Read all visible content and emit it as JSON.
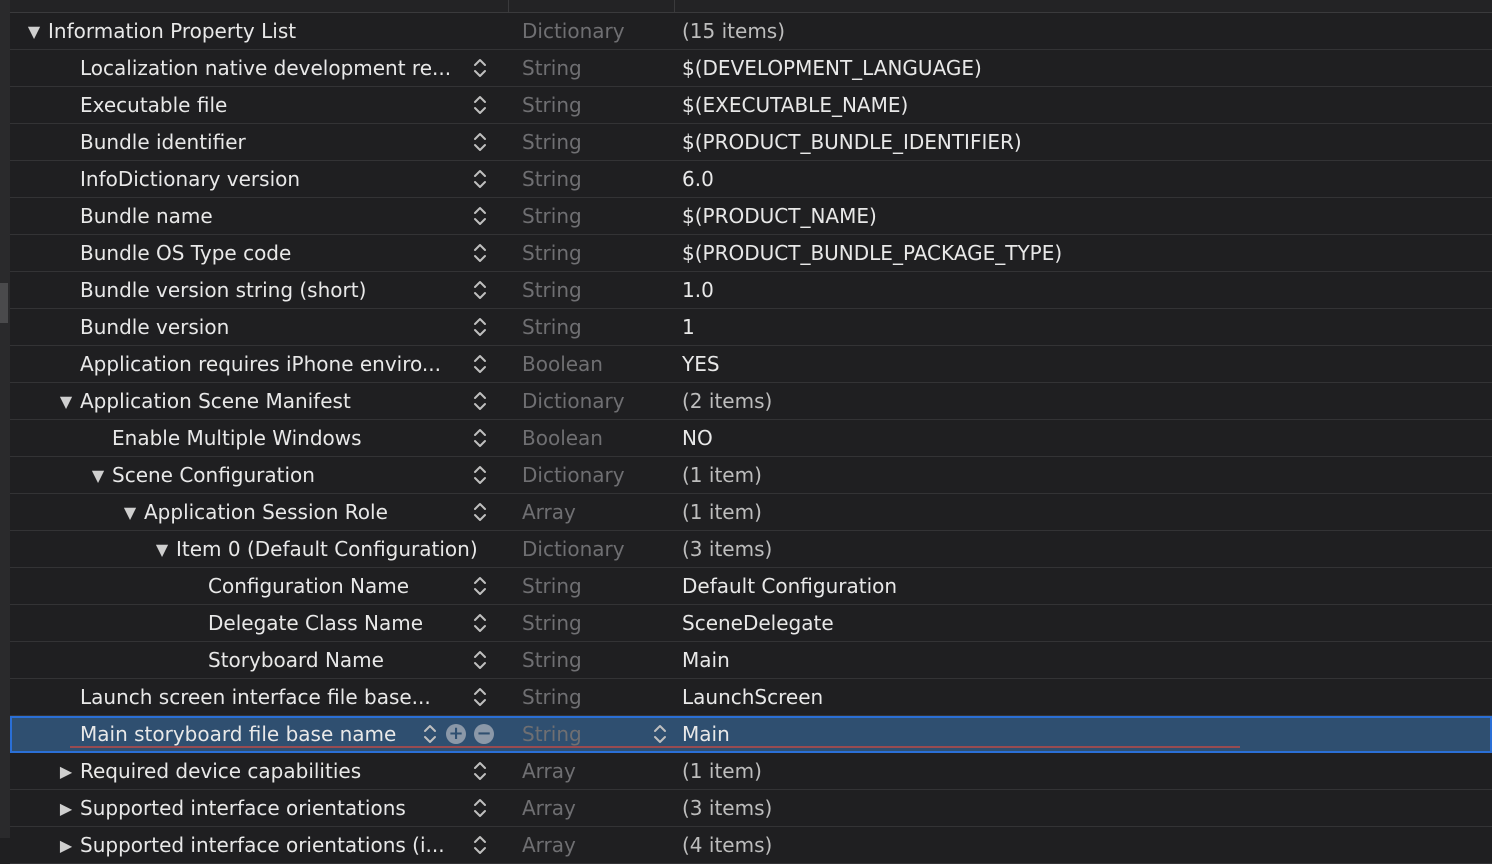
{
  "rows": [
    {
      "key": "Information Property List",
      "type": "Dictionary",
      "value": "(15 items)",
      "indent": 0,
      "disclosure": "expanded",
      "stepper": false
    },
    {
      "key": "Localization native development re...",
      "type": "String",
      "value": "$(DEVELOPMENT_LANGUAGE)",
      "indent": 1,
      "disclosure": "none",
      "stepper": true
    },
    {
      "key": "Executable file",
      "type": "String",
      "value": "$(EXECUTABLE_NAME)",
      "indent": 1,
      "disclosure": "none",
      "stepper": true
    },
    {
      "key": "Bundle identifier",
      "type": "String",
      "value": "$(PRODUCT_BUNDLE_IDENTIFIER)",
      "indent": 1,
      "disclosure": "none",
      "stepper": true
    },
    {
      "key": "InfoDictionary version",
      "type": "String",
      "value": "6.0",
      "indent": 1,
      "disclosure": "none",
      "stepper": true
    },
    {
      "key": "Bundle name",
      "type": "String",
      "value": "$(PRODUCT_NAME)",
      "indent": 1,
      "disclosure": "none",
      "stepper": true
    },
    {
      "key": "Bundle OS Type code",
      "type": "String",
      "value": "$(PRODUCT_BUNDLE_PACKAGE_TYPE)",
      "indent": 1,
      "disclosure": "none",
      "stepper": true
    },
    {
      "key": "Bundle version string (short)",
      "type": "String",
      "value": "1.0",
      "indent": 1,
      "disclosure": "none",
      "stepper": true
    },
    {
      "key": "Bundle version",
      "type": "String",
      "value": "1",
      "indent": 1,
      "disclosure": "none",
      "stepper": true
    },
    {
      "key": "Application requires iPhone enviro...",
      "type": "Boolean",
      "value": "YES",
      "indent": 1,
      "disclosure": "none",
      "stepper": true
    },
    {
      "key": "Application Scene Manifest",
      "type": "Dictionary",
      "value": "(2 items)",
      "indent": 1,
      "disclosure": "expanded",
      "stepper": true
    },
    {
      "key": "Enable Multiple Windows",
      "type": "Boolean",
      "value": "NO",
      "indent": 2,
      "disclosure": "none",
      "stepper": true
    },
    {
      "key": "Scene Configuration",
      "type": "Dictionary",
      "value": "(1 item)",
      "indent": 2,
      "disclosure": "expanded",
      "stepper": true
    },
    {
      "key": "Application Session Role",
      "type": "Array",
      "value": "(1 item)",
      "indent": 3,
      "disclosure": "expanded",
      "stepper": true
    },
    {
      "key": "Item 0 (Default Configuration)",
      "type": "Dictionary",
      "value": "(3 items)",
      "indent": 4,
      "disclosure": "expanded",
      "stepper": false
    },
    {
      "key": "Configuration Name",
      "type": "String",
      "value": "Default Configuration",
      "indent": 5,
      "disclosure": "none",
      "stepper": true
    },
    {
      "key": "Delegate Class Name",
      "type": "String",
      "value": "SceneDelegate",
      "indent": 5,
      "disclosure": "none",
      "stepper": true
    },
    {
      "key": "Storyboard Name",
      "type": "String",
      "value": "Main",
      "indent": 5,
      "disclosure": "none",
      "stepper": true
    },
    {
      "key": "Launch screen interface file base...",
      "type": "String",
      "value": "LaunchScreen",
      "indent": 1,
      "disclosure": "none",
      "stepper": true
    },
    {
      "key": "Main storyboard file base name",
      "type": "String",
      "value": "Main",
      "indent": 1,
      "disclosure": "none",
      "stepper": true,
      "selected": true
    },
    {
      "key": "Required device capabilities",
      "type": "Array",
      "value": "(1 item)",
      "indent": 1,
      "disclosure": "collapsed",
      "stepper": true
    },
    {
      "key": "Supported interface orientations",
      "type": "Array",
      "value": "(3 items)",
      "indent": 1,
      "disclosure": "collapsed",
      "stepper": true
    },
    {
      "key": "Supported interface orientations (i...",
      "type": "Array",
      "value": "(4 items)",
      "indent": 1,
      "disclosure": "collapsed",
      "stepper": true
    }
  ],
  "add_glyph": "+",
  "remove_glyph": "−",
  "colors": {
    "background": "#1f1f21",
    "selection": "#2f4f70",
    "selection_border": "#2a6fd6",
    "type_text": "#6f6f72",
    "key_text": "#e8e8e8"
  }
}
